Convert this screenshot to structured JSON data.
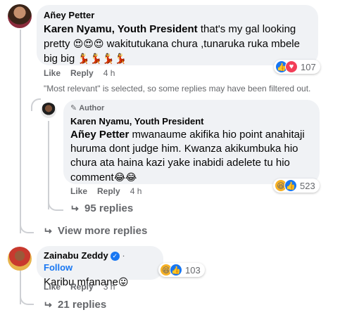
{
  "comment1": {
    "author": "Añey Petter",
    "mention": "Karen Nyamu, Youth President",
    "text_part1": " that's my gal looking pretty ",
    "emoji1": "😍😍😍",
    "text_part2": " wakitutukana chura ,tunaruka ruka mbele big big ",
    "emoji2": "💃💃💃💃",
    "like_label": "Like",
    "reply_label": "Reply",
    "time": "4 h",
    "reaction_count": "107",
    "note": "\"Most relevant\" is selected, so some replies may have been filtered out."
  },
  "reply1": {
    "author_tag": "Author",
    "author": "Karen Nyamu, Youth President",
    "mention": "Añey Petter",
    "text": " mwanaume akifika hio point anahitaji huruma dont judge him. Kwanza akikumbuka hio chura ata haina kazi yake inabidi adelete tu hio comment",
    "emoji": "😂😂",
    "like_label": "Like",
    "reply_label": "Reply",
    "time": "4 h",
    "reaction_count": "523",
    "more_replies": "95 replies"
  },
  "view_more": "View more replies",
  "comment2": {
    "author": "Zainabu Zeddy",
    "separator": "·",
    "follow_label": "Follow",
    "text": "Karibu mfanane",
    "emoji": "😛",
    "like_label": "Like",
    "reply_label": "Reply",
    "time": "3 h",
    "reaction_count": "103",
    "more_replies": "21 replies"
  },
  "colors": {
    "link": "#1877f2",
    "muted": "#65676b",
    "bubble": "#f0f2f5"
  },
  "icons": [
    "like-icon",
    "love-icon",
    "haha-icon",
    "reply-arrow-icon",
    "pencil-icon",
    "verified-icon"
  ]
}
